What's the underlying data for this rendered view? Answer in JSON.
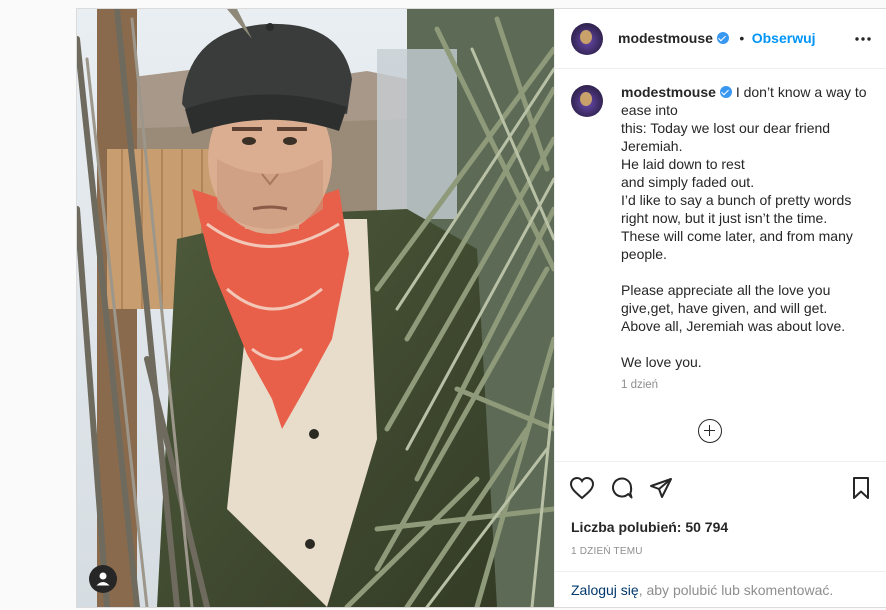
{
  "header": {
    "username": "modestmouse",
    "follow_label": "Obserwuj",
    "more_label": "•••"
  },
  "caption": {
    "username": "modestmouse",
    "text": "I don’t know a way to ease into\nthis: Today we lost our dear friend Jeremiah.\nHe laid down to rest\nand simply faded out.\nI’d like to say a bunch of pretty words right now, but it just isn’t the time.\nThese will come later, and from many people.\n\nPlease appreciate all the love you give,get, have given, and will get.\nAbove all, Jeremiah was about love.\n\nWe love you.",
    "time": "1 dzień"
  },
  "stats": {
    "likes": "Liczba polubień: 50 794",
    "timestamp": "1 DZIEŃ TEMU"
  },
  "login": {
    "link": "Zaloguj się",
    "rest": ", aby polubić lub skomentować."
  },
  "icons": {
    "like": "heart-icon",
    "comment": "comment-icon",
    "share": "paper-plane-icon",
    "save": "bookmark-icon",
    "load_more": "plus-circle-icon",
    "tags": "user-tag-icon",
    "verified": "verified-badge-icon"
  },
  "colors": {
    "accent": "#0095f6",
    "verified": "#3897f0",
    "bandana": "#e8604a",
    "jacket": "#4b5638"
  }
}
